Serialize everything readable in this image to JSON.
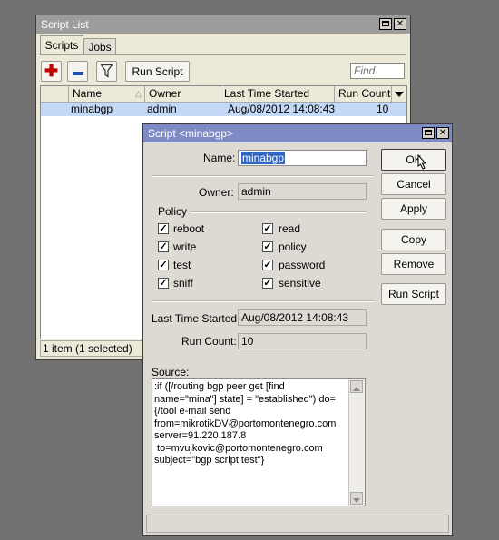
{
  "script_list": {
    "title": "Script List",
    "tabs": [
      "Scripts",
      "Jobs"
    ],
    "toolbar": {
      "run_script": "Run Script",
      "find_placeholder": "Find"
    },
    "columns": {
      "name": "Name",
      "owner": "Owner",
      "last_started": "Last Time Started",
      "run_count": "Run Count"
    },
    "rows": [
      {
        "name": "minabgp",
        "owner": "admin",
        "last_started": "Aug/08/2012 14:08:43",
        "run_count": "10"
      }
    ],
    "status": "1 item (1 selected)"
  },
  "script_dialog": {
    "title": "Script <minabgp>",
    "name_label": "Name:",
    "name_value": "minabgp",
    "owner_label": "Owner:",
    "owner_value": "admin",
    "policy_label": "Policy",
    "policies": {
      "reboot": "reboot",
      "read": "read",
      "write": "write",
      "policy": "policy",
      "test": "test",
      "password": "password",
      "sniff": "sniff",
      "sensitive": "sensitive"
    },
    "last_started_label": "Last Time Started:",
    "last_started_value": "Aug/08/2012 14:08:43",
    "run_count_label": "Run Count:",
    "run_count_value": "10",
    "source_label": "Source:",
    "source_lines": [
      ":if ([/routing bgp peer get [find",
      "name=\"mina\"] state] = \"established\") do=",
      "{/tool e-mail send",
      "from=mikrotikDV@portomontenegro.com",
      "server=91.220.187.8",
      " to=mvujkovic@portomontenegro.com",
      "subject=\"bgp script test\"}"
    ],
    "buttons": {
      "ok": "OK",
      "cancel": "Cancel",
      "apply": "Apply",
      "copy": "Copy",
      "remove": "Remove",
      "run_script": "Run Script"
    }
  }
}
